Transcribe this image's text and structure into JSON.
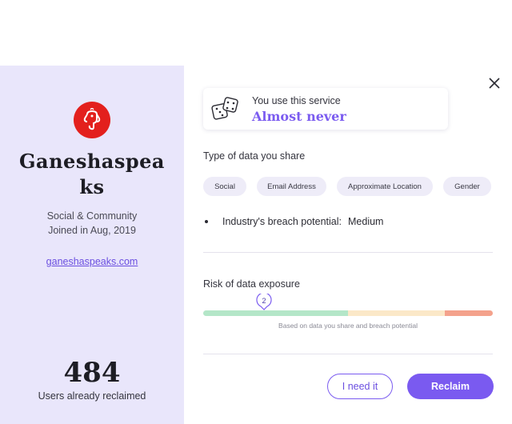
{
  "service": {
    "name": "Ganeshaspeaks",
    "category": "Social & Community",
    "joined": "Joined in Aug, 2019",
    "website": "ganeshaspeaks.com",
    "brand_color": "#e3201d"
  },
  "stats": {
    "reclaimed_count": "484",
    "reclaimed_label": "Users already reclaimed"
  },
  "usage": {
    "label": "You use this service",
    "value": "Almost never",
    "icon": "dice-icon"
  },
  "data_shared": {
    "title": "Type of data you share",
    "types": [
      "Social",
      "Email Address",
      "Approximate Location",
      "Gender"
    ]
  },
  "breach": {
    "label": "Industry's breach potential:",
    "value": "Medium"
  },
  "risk": {
    "title": "Risk of data exposure",
    "score": "2",
    "note": "Based on data you share and breach potential",
    "colors": {
      "low": "#b4e6c8",
      "medium": "#fbe8c8",
      "high": "#f4a28c"
    }
  },
  "actions": {
    "need_it": "I need it",
    "reclaim": "Reclaim"
  },
  "colors": {
    "accent": "#7a5af0",
    "panel_bg": "#e9e6fb"
  }
}
